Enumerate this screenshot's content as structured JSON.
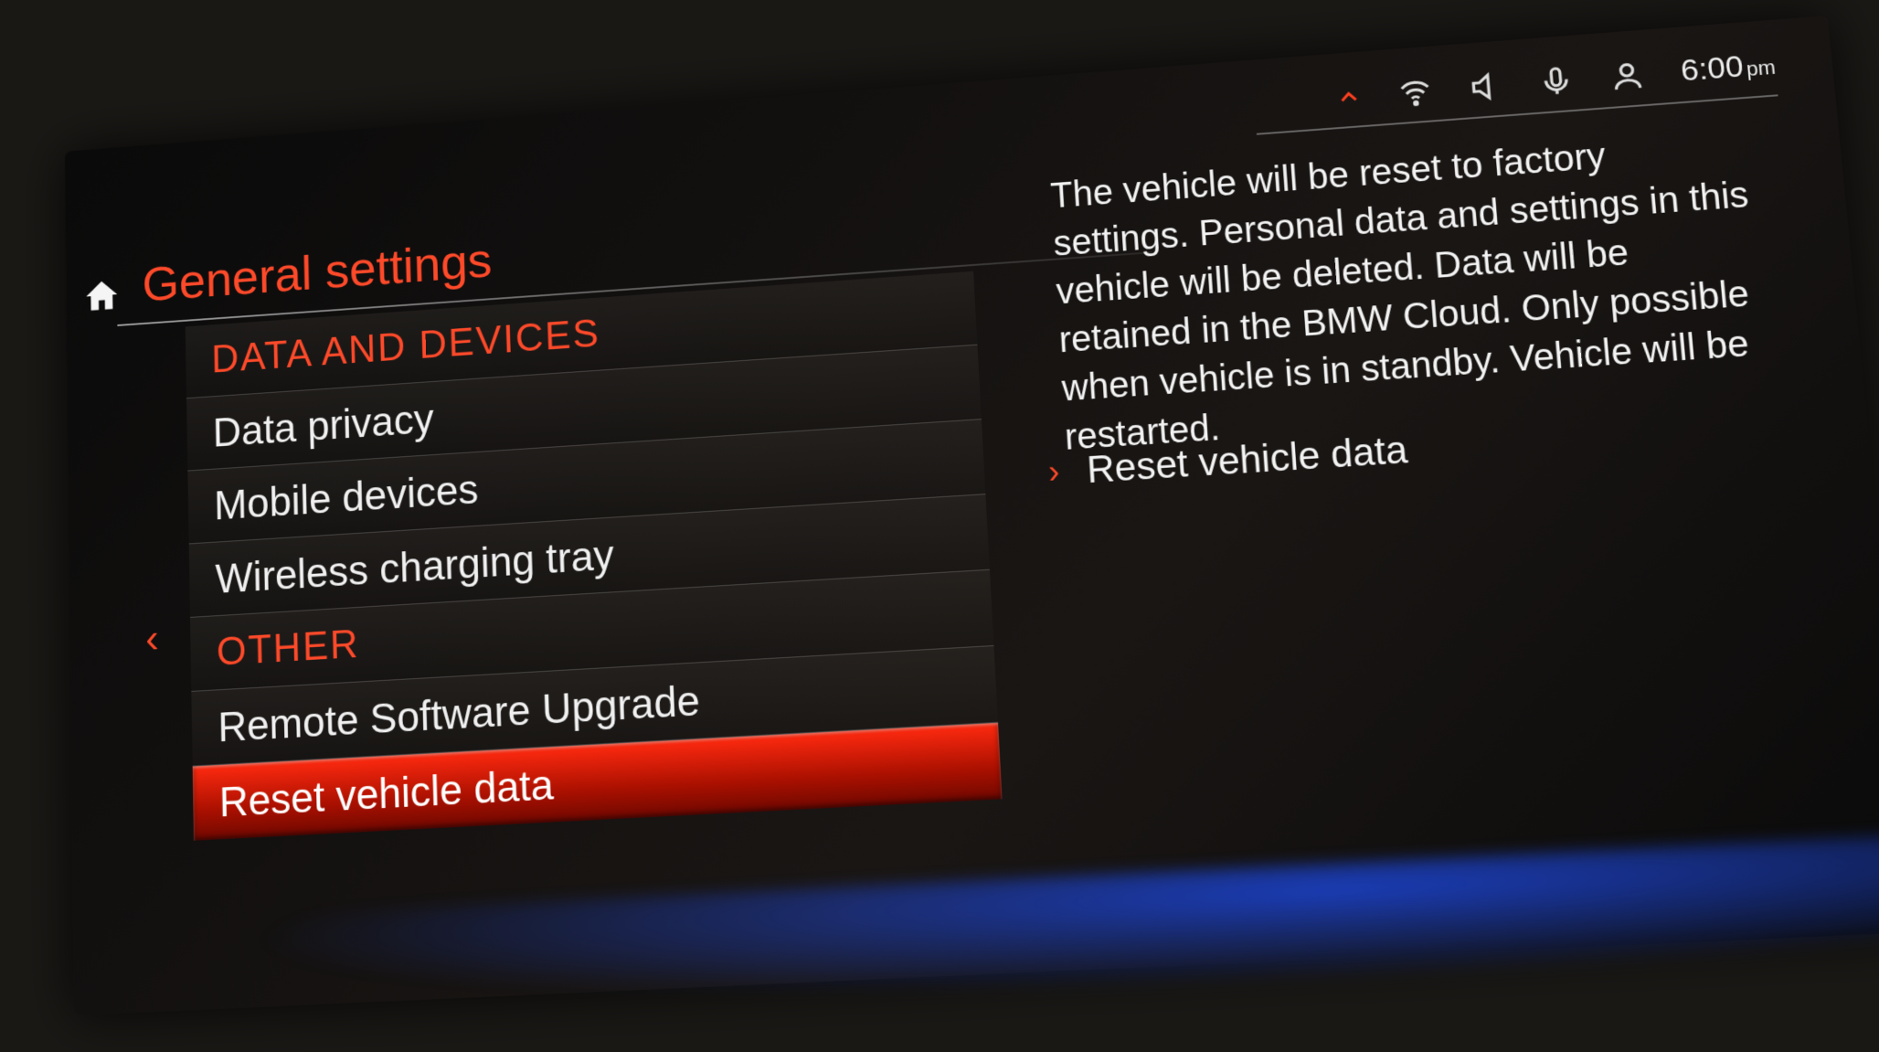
{
  "status_bar": {
    "alert_icon": "chevron-up-alert",
    "wifi_icon": "wifi",
    "speaker_icon": "speaker",
    "mic_icon": "microphone",
    "profile_icon": "profile",
    "time": "6:00",
    "ampm": "pm"
  },
  "title": "General settings",
  "menu": {
    "section1_label": "DATA AND DEVICES",
    "items1": {
      "data_privacy": "Data privacy",
      "mobile_devices": "Mobile devices",
      "wireless_tray": "Wireless charging tray"
    },
    "section2_label": "OTHER",
    "items2": {
      "rsu": "Remote Software Upgrade",
      "reset": "Reset vehicle data"
    },
    "selected": "reset"
  },
  "detail": {
    "text": "The vehicle will be reset to factory settings. Personal data and settings in this vehicle will be deleted. Data will be retained in the BMW Cloud. Only possible when vehicle is in standby. Vehicle will be restarted.",
    "action_label": "Reset vehicle data"
  },
  "colors": {
    "accent": "#ff4a2a",
    "text": "#f0f0f0",
    "bg": "#0a0a0a"
  }
}
